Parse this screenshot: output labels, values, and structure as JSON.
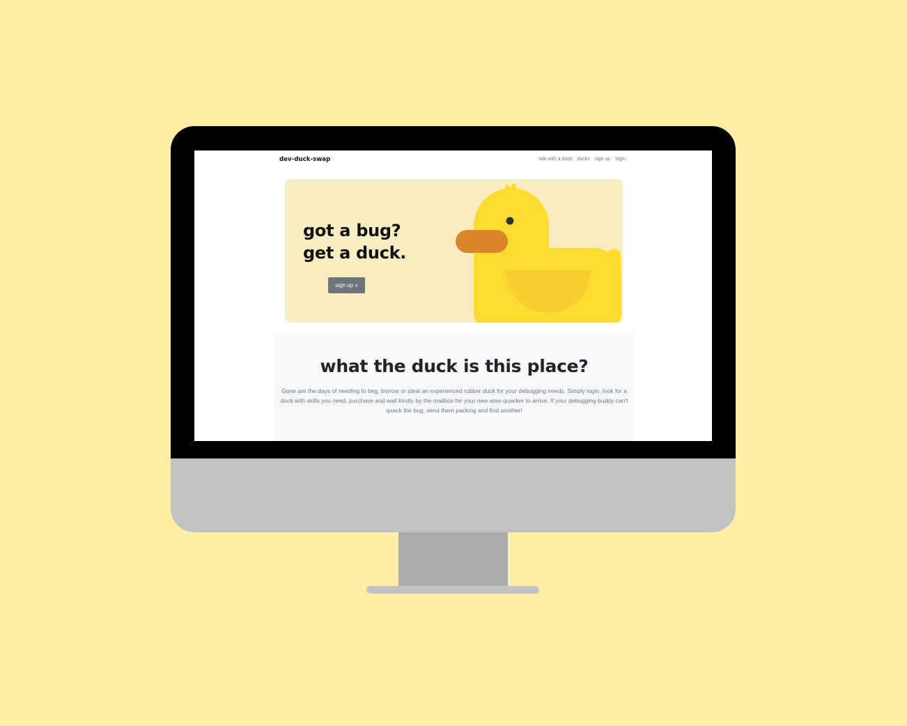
{
  "site": {
    "brand": "dev-duck-swap",
    "nav": [
      "talk with a duck",
      "ducks",
      "sign up",
      "login"
    ]
  },
  "hero": {
    "title_line1": "got a bug?",
    "title_line2": "get a duck.",
    "button_label": "sign up »"
  },
  "about": {
    "title": "what the duck is this place?",
    "text": "Gone are the days of needing to beg, borrow or steal an experienced rubber duck for your debugging needs. Simply login, look for a duck with skills you need, purchase and wait kindly by the mailbox for your new wise quacker to arrive. If your debugging buddy can't quack the bug, send them packing and find another!"
  },
  "colors": {
    "page_background": "#ffeea3",
    "hero_background": "#f8edc0",
    "duck_yellow": "#fedb2f",
    "duck_wing": "#f7cd2f",
    "duck_beak": "#d9862a",
    "button_gray": "#6c757d"
  },
  "icons": {
    "hero_illustration": "rubber-duck-icon"
  }
}
